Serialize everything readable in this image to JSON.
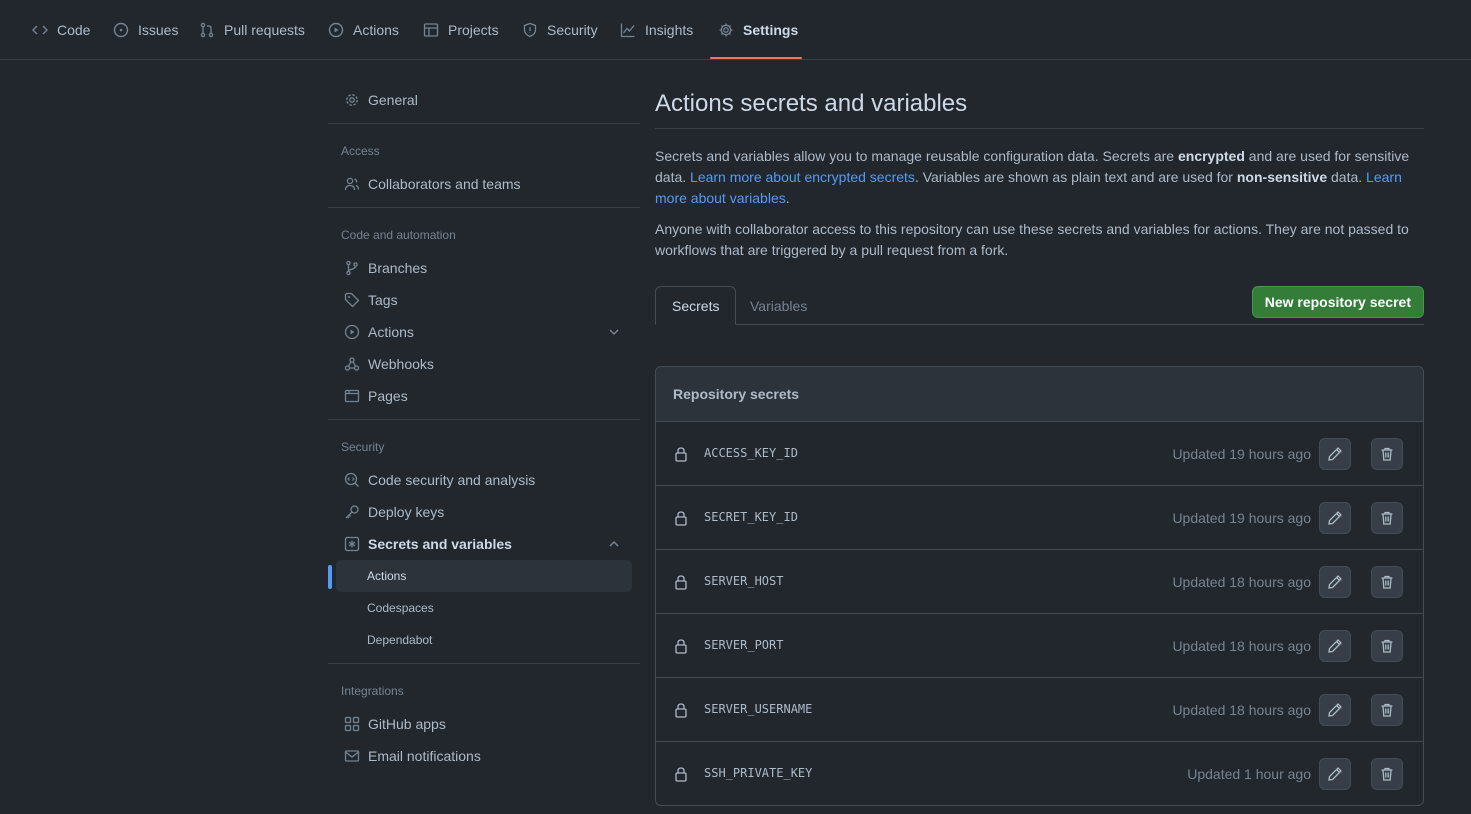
{
  "nav": {
    "tabs": [
      {
        "label": "Code",
        "icon": "code-icon"
      },
      {
        "label": "Issues",
        "icon": "issue-opened-icon"
      },
      {
        "label": "Pull requests",
        "icon": "git-pull-request-icon"
      },
      {
        "label": "Actions",
        "icon": "play-icon"
      },
      {
        "label": "Projects",
        "icon": "table-icon"
      },
      {
        "label": "Security",
        "icon": "shield-icon"
      },
      {
        "label": "Insights",
        "icon": "graph-icon"
      },
      {
        "label": "Settings",
        "icon": "gear-icon",
        "active": true
      }
    ]
  },
  "sidebar": {
    "general": "General",
    "access_heading": "Access",
    "collaborators": "Collaborators and teams",
    "code_automation_heading": "Code and automation",
    "branches": "Branches",
    "tags": "Tags",
    "actions": "Actions",
    "webhooks": "Webhooks",
    "pages": "Pages",
    "security_heading": "Security",
    "code_security": "Code security and analysis",
    "deploy_keys": "Deploy keys",
    "secrets_variables": "Secrets and variables",
    "sub_actions": "Actions",
    "sub_codespaces": "Codespaces",
    "sub_dependabot": "Dependabot",
    "integrations_heading": "Integrations",
    "github_apps": "GitHub apps",
    "email_notifications": "Email notifications"
  },
  "main": {
    "title": "Actions secrets and variables",
    "para1": {
      "t1": "Secrets and variables allow you to manage reusable configuration data. Secrets are ",
      "b1": "encrypted",
      "t2": " and are used for sensitive data. ",
      "link1": "Learn more about encrypted secrets",
      "t3": ". Variables are shown as plain text and are used for ",
      "b2": "non-sensitive",
      "t4": " data. ",
      "link2": "Learn more about variables",
      "t5": "."
    },
    "para2": "Anyone with collaborator access to this repository can use these secrets and variables for actions. They are not passed to workflows that are triggered by a pull request from a fork.",
    "tab_secrets": "Secrets",
    "tab_variables": "Variables",
    "new_secret_button": "New repository secret",
    "box_heading": "Repository secrets",
    "secrets": [
      {
        "name": "ACCESS_KEY_ID",
        "updated": "Updated 19 hours ago"
      },
      {
        "name": "SECRET_KEY_ID",
        "updated": "Updated 19 hours ago"
      },
      {
        "name": "SERVER_HOST",
        "updated": "Updated 18 hours ago"
      },
      {
        "name": "SERVER_PORT",
        "updated": "Updated 18 hours ago"
      },
      {
        "name": "SERVER_USERNAME",
        "updated": "Updated 18 hours ago"
      },
      {
        "name": "SSH_PRIVATE_KEY",
        "updated": "Updated 1 hour ago"
      }
    ]
  },
  "colors": {
    "background": "#22272e",
    "accent_link": "#539bf5",
    "primary_button": "#347d39",
    "active_tab_underline": "#ec775c"
  }
}
